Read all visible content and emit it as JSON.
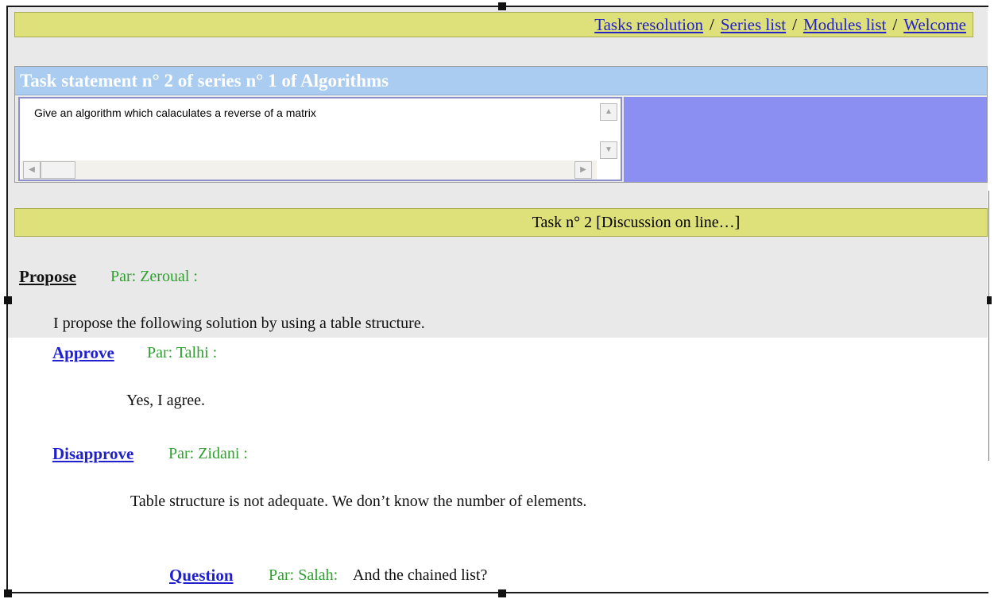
{
  "nav": {
    "items": [
      "Tasks resolution",
      "Series list",
      "Modules list",
      "Welcome"
    ],
    "separator": "/"
  },
  "task": {
    "title": "Task statement n° 2 of series n° 1 of Algorithms",
    "statement": "Give an algorithm  which calaculates a reverse of a matrix"
  },
  "discussion": {
    "header": "Task n° 2 [Discussion on line…]",
    "posts": [
      {
        "type": "Propose",
        "author": "Par: Zeroual :",
        "body": "I propose the following solution by using a table structure."
      },
      {
        "type": "Approve",
        "author": "Par: Talhi :",
        "body": "Yes, I agree."
      },
      {
        "type": "Disapprove",
        "author": "Par: Zidani :",
        "body": "Table structure is not adequate. We don’t know the number of elements."
      },
      {
        "type": "Question",
        "author": "Par: Salah:",
        "body": "And the chained list?"
      }
    ]
  },
  "colors": {
    "nav_bg": "#dee07a",
    "title_bar": "#a9ccf0",
    "side_panel": "#8c8ff2",
    "link": "#2020d0",
    "author": "#2fa02f"
  },
  "icons": [
    "scroll-up-arrow",
    "scroll-down-arrow",
    "scroll-left-arrow",
    "scroll-right-arrow"
  ]
}
